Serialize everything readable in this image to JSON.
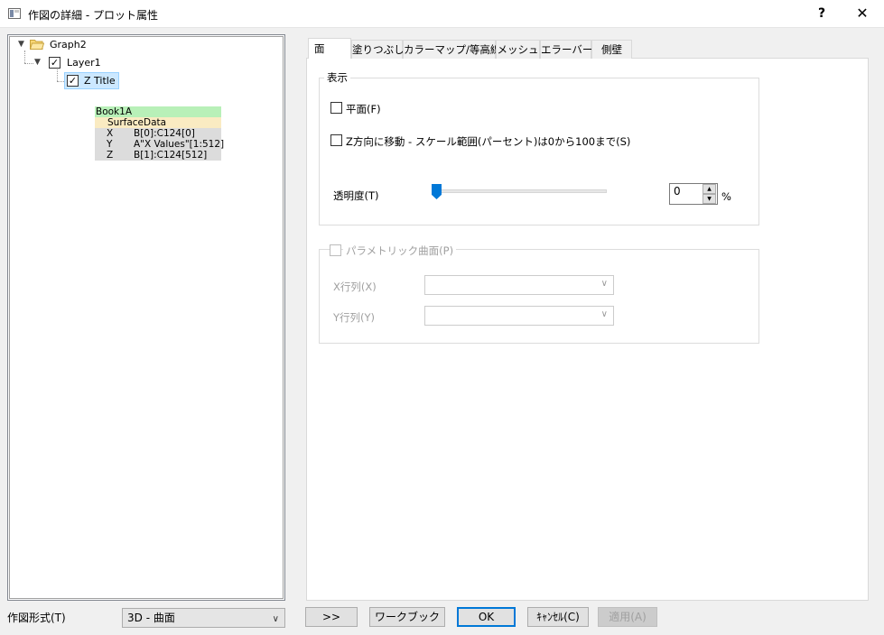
{
  "window": {
    "title": "作図の詳細 - プロット属性",
    "help_label": "?",
    "close_label": "✕"
  },
  "tree": {
    "root": "Graph2",
    "layer": "Layer1",
    "plot": "Z Title",
    "layer_checked": "✓",
    "plot_checked": "✓",
    "dataset": {
      "book": "Book1A",
      "sheet": "SurfaceData",
      "rows": [
        {
          "col": "X",
          "ref": "B[0]:C124[0]"
        },
        {
          "col": "Y",
          "ref": "A\"X Values\"[1:512]"
        },
        {
          "col": "Z",
          "ref": "B[1]:C124[512]"
        }
      ]
    }
  },
  "tabs": [
    {
      "label": "面"
    },
    {
      "label": "塗りつぶし"
    },
    {
      "label": "カラーマップ/等高線"
    },
    {
      "label": "メッシュ"
    },
    {
      "label": "エラーバー"
    },
    {
      "label": "側壁"
    }
  ],
  "display_group": {
    "title": "表示",
    "flat_label": "平面(F)",
    "shift_z_label": "Z方向に移動 - スケール範囲(パーセント)は0から100まで(S)",
    "transparency_label": "透明度(T)",
    "transparency_value": "0",
    "transparency_unit": "%",
    "transparency_fraction": 0
  },
  "parametric_group": {
    "title": "パラメトリック曲面(P)",
    "x_matrix_label": "X行列(X)",
    "y_matrix_label": "Y行列(Y)",
    "x_matrix_value": "",
    "y_matrix_value": ""
  },
  "footer": {
    "plot_type_label": "作図形式(T)",
    "plot_type_value": "3D - 曲面",
    "expand_button": ">>",
    "workbook_button": "ワークブック",
    "ok_button": "OK",
    "cancel_button": "ｷｬﾝｾﾙ(C)",
    "apply_button": "適用(A)"
  }
}
